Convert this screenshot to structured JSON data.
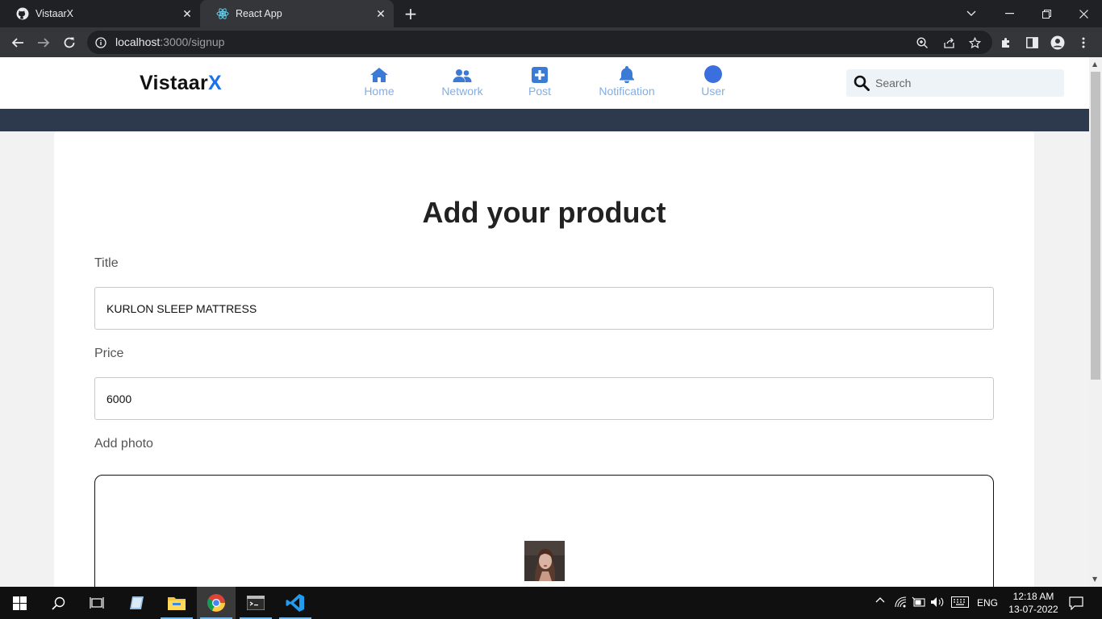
{
  "browser": {
    "tabs": [
      {
        "title": "VistaarX",
        "icon": "github-icon"
      },
      {
        "title": "React App",
        "icon": "react-icon"
      }
    ],
    "url_host": "localhost",
    "url_path": ":3000/signup"
  },
  "app": {
    "brand_main": "Vistaar",
    "brand_accent": "X",
    "nav": [
      {
        "label": "Home",
        "icon": "home-icon"
      },
      {
        "label": "Network",
        "icon": "users-icon"
      },
      {
        "label": "Post",
        "icon": "plus-square-icon"
      },
      {
        "label": "Notification",
        "icon": "bell-icon"
      },
      {
        "label": "User",
        "icon": "avatar-icon"
      }
    ],
    "search_placeholder": "Search"
  },
  "form": {
    "heading": "Add your product",
    "title_label": "Title",
    "title_value": "KURLON SLEEP MATTRESS",
    "price_label": "Price",
    "price_value": "6000",
    "photo_label": "Add photo"
  },
  "taskbar": {
    "language": "ENG",
    "time": "12:18 AM",
    "date": "13-07-2022"
  },
  "colors": {
    "brand_accent": "#1a73e8",
    "nav_icon": "#3b7bd6",
    "band": "#2d3a4e"
  }
}
